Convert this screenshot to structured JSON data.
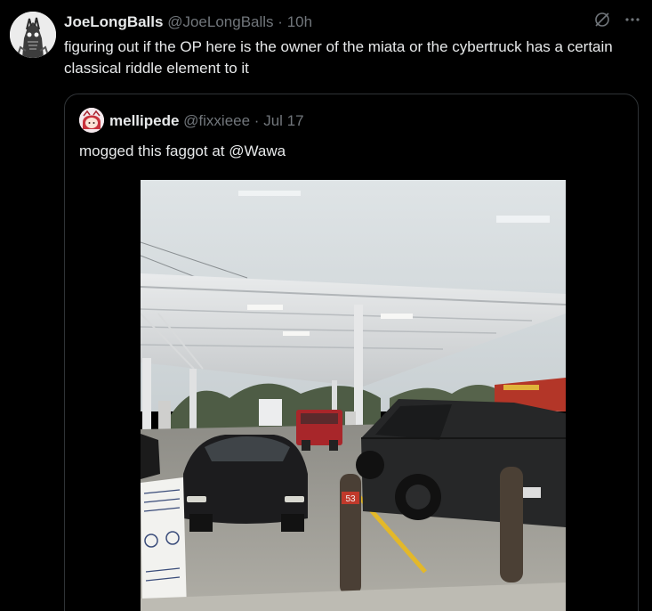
{
  "tweet": {
    "display_name": "JoeLongBalls",
    "handle": "@JoeLongBalls",
    "separator": "·",
    "time": "10h",
    "text": "figuring out if the OP here is the owner of the miata or the cybertruck has a certain classical riddle element to it",
    "icons": [
      "grok-icon",
      "more-icon"
    ]
  },
  "quote": {
    "display_name": "mellipede",
    "handle": "@fixxieee",
    "separator": "·",
    "time": "Jul 17",
    "text": "mogged this faggot at @Wawa",
    "photo": {
      "pillar_number": "53"
    }
  },
  "colors": {
    "background": "#000000",
    "text": "#e7e9ea",
    "muted": "#71767b",
    "border": "#2f3336"
  }
}
